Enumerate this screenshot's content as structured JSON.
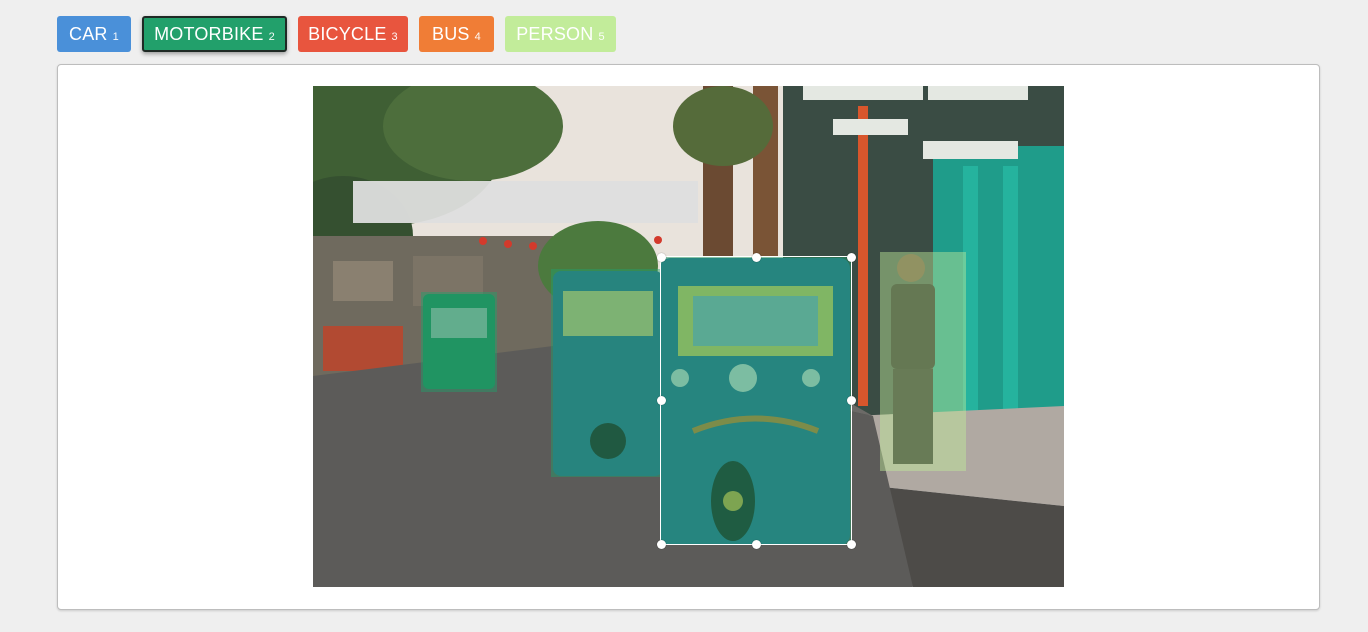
{
  "labels": [
    {
      "name": "CAR",
      "hotkey": "1",
      "color": "#4a90d9"
    },
    {
      "name": "MOTORBIKE",
      "hotkey": "2",
      "color": "#22a06b",
      "active": true
    },
    {
      "name": "BICYCLE",
      "hotkey": "3",
      "color": "#e8553e"
    },
    {
      "name": "BUS",
      "hotkey": "4",
      "color": "#f07d36"
    },
    {
      "name": "PERSON",
      "hotkey": "5",
      "color": "#c2ec9a"
    }
  ],
  "image_subject": "street scene with tuk-tuks and a man standing on the sidewalk",
  "annotations": [
    {
      "label": "MOTORBIKE",
      "color": "#22a06b",
      "selected": false
    },
    {
      "label": "MOTORBIKE",
      "color": "#22a06b",
      "selected": false
    },
    {
      "label": "MOTORBIKE",
      "color": "#22a06b",
      "selected": true
    },
    {
      "label": "PERSON",
      "color": "#c2ec9a",
      "selected": false
    }
  ]
}
